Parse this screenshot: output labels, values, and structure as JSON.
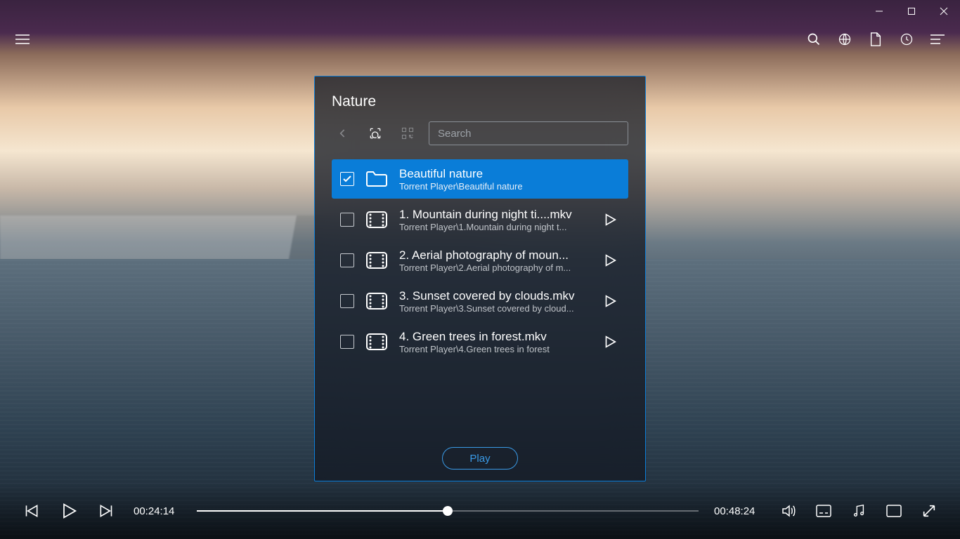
{
  "panel": {
    "title": "Nature",
    "search_placeholder": "Search",
    "play_label": "Play"
  },
  "items": [
    {
      "title": "Beautiful nature",
      "sub": "Torrent Player\\Beautiful nature",
      "type": "folder",
      "checked": true,
      "selected": true
    },
    {
      "title": "1. Mountain during night ti....mkv",
      "sub": "Torrent Player\\1.Mountain during night t...",
      "type": "video",
      "checked": false,
      "selected": false
    },
    {
      "title": "2. Aerial photography of moun...",
      "sub": "Torrent Player\\2.Aerial photography of m...",
      "type": "video",
      "checked": false,
      "selected": false
    },
    {
      "title": "3. Sunset covered by clouds.mkv",
      "sub": "Torrent Player\\3.Sunset covered by cloud...",
      "type": "video",
      "checked": false,
      "selected": false
    },
    {
      "title": "4. Green trees in forest.mkv",
      "sub": "Torrent Player\\4.Green trees in forest",
      "type": "video",
      "checked": false,
      "selected": false
    }
  ],
  "playback": {
    "current": "00:24:14",
    "total": "00:48:24",
    "progress_pct": 50
  }
}
